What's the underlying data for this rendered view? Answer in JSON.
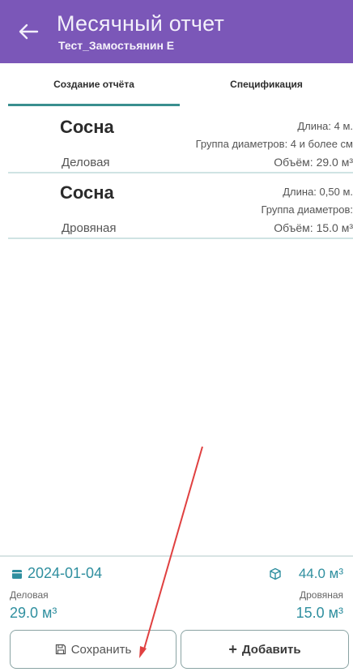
{
  "header": {
    "title": "Месячный отчет",
    "subtitle": "Тест_Замостьянин Е"
  },
  "tabs": [
    {
      "label": "Создание отчёта",
      "active": true
    },
    {
      "label": "Спецификация",
      "active": false
    }
  ],
  "items": [
    {
      "species": "Сосна",
      "grade": "Деловая",
      "length": "Длина: 4 м.",
      "diameter_group": "Группа диаметров: 4 и более см",
      "volume": "Объём: 29.0 м³"
    },
    {
      "species": "Сосна",
      "grade": "Дровяная",
      "length": "Длина: 0,50 м.",
      "diameter_group": "Группа диаметров:",
      "volume": "Объём: 15.0 м³"
    }
  ],
  "summary": {
    "date": "2024-01-04",
    "total": "44.0 м³",
    "left_label": "Деловая",
    "left_value": "29.0 м³",
    "right_label": "Дровяная",
    "right_value": "15.0 м³"
  },
  "actions": {
    "save_label": "Сохранить",
    "add_label": "Добавить"
  },
  "colors": {
    "appbar": "#7b57b8",
    "accent": "#2f8f9f",
    "annotation_arrow": "#e04040"
  }
}
